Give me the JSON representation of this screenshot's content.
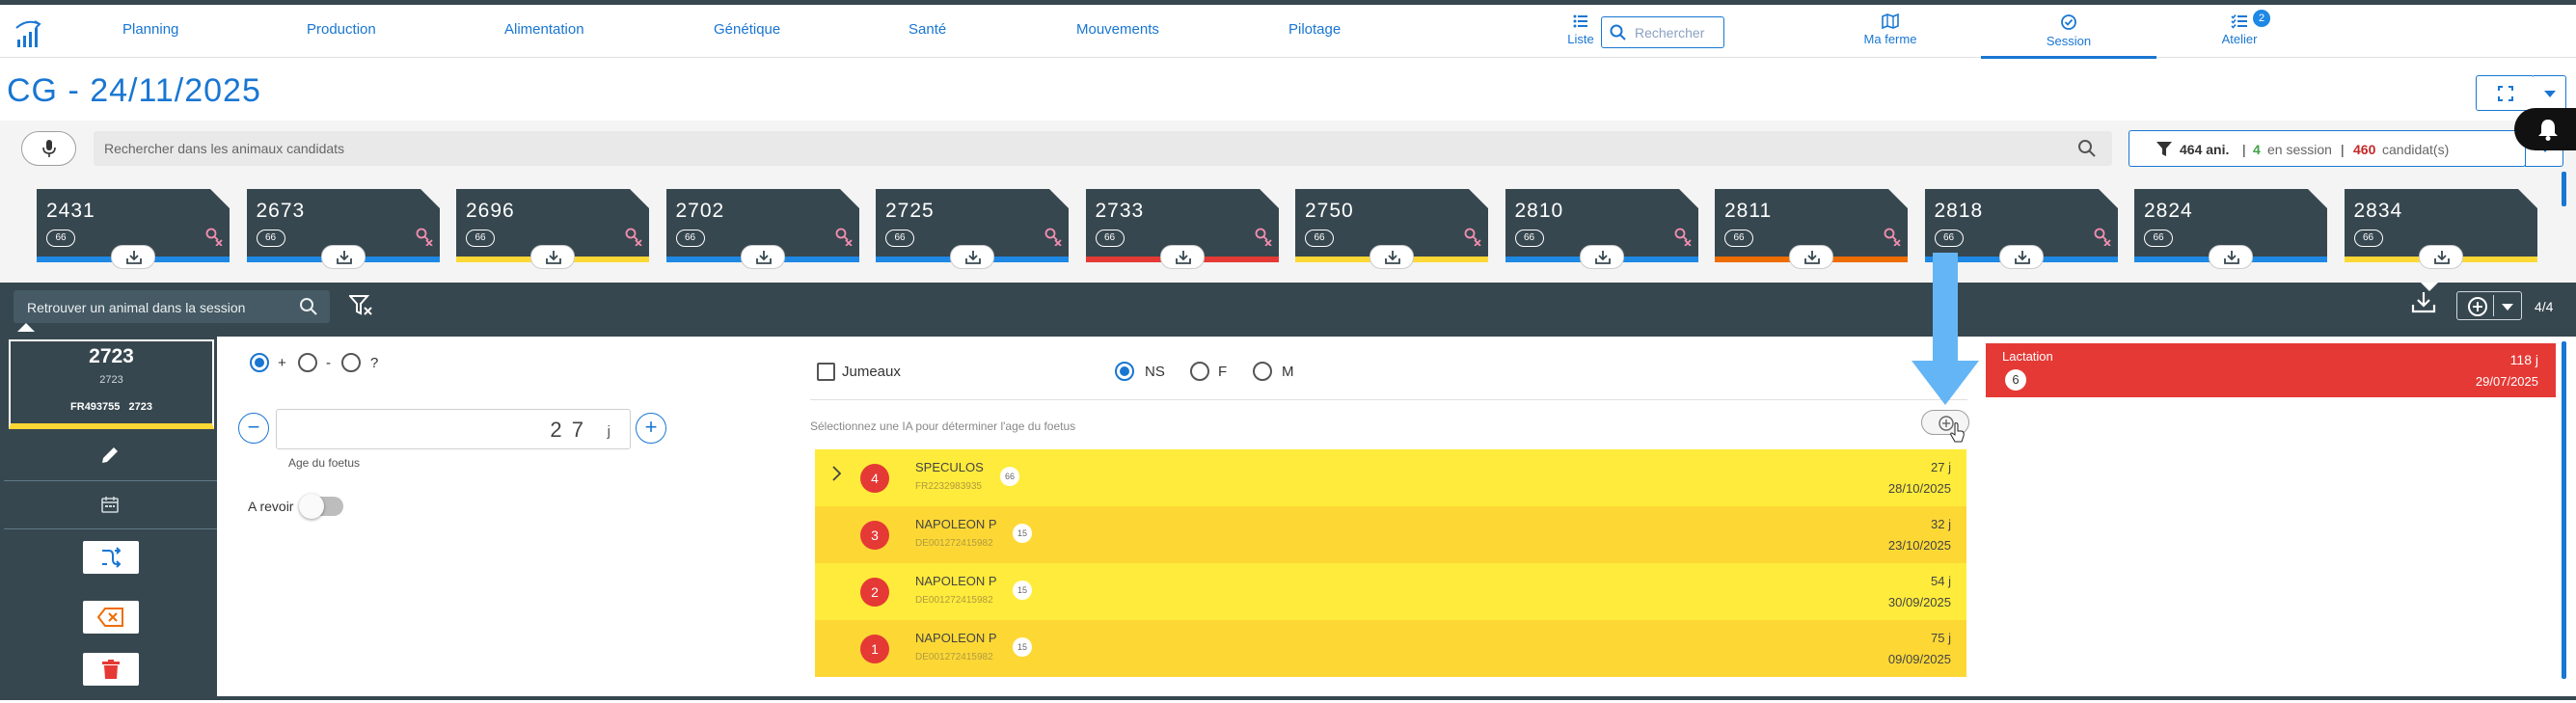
{
  "nav": {
    "items": [
      "Planning",
      "Production",
      "Alimentation",
      "Génétique",
      "Santé",
      "Mouvements",
      "Pilotage"
    ],
    "liste_label": "Liste",
    "search_placeholder": "Rechercher",
    "ma_ferme_label": "Ma ferme",
    "session_label": "Session",
    "atelier_label": "Atelier",
    "atelier_badge": "2"
  },
  "page": {
    "title": "CG - 24/11/2025"
  },
  "candidates": {
    "search_placeholder": "Rechercher dans les animaux candidats",
    "filter": {
      "total": "464 ani.",
      "sep1": "|",
      "in_session_count": "4",
      "in_session_label": "en session",
      "sep2": "|",
      "candidates_count": "460",
      "candidates_label": "candidat(s)"
    },
    "cards": [
      {
        "num": "2431",
        "pill": "66",
        "bar": "#1e88e5",
        "gender": true
      },
      {
        "num": "2673",
        "pill": "66",
        "bar": "#1e88e5",
        "gender": true
      },
      {
        "num": "2696",
        "pill": "66",
        "bar": "#fdd835",
        "gender": true
      },
      {
        "num": "2702",
        "pill": "66",
        "bar": "#1e88e5",
        "gender": true
      },
      {
        "num": "2725",
        "pill": "66",
        "bar": "#1e88e5",
        "gender": true
      },
      {
        "num": "2733",
        "pill": "66",
        "bar": "#e53935",
        "gender": true
      },
      {
        "num": "2750",
        "pill": "66",
        "bar": "#fdd835",
        "gender": true
      },
      {
        "num": "2810",
        "pill": "66",
        "bar": "#1e88e5",
        "gender": true
      },
      {
        "num": "2811",
        "pill": "66",
        "bar": "#ef6c00",
        "gender": true
      },
      {
        "num": "2818",
        "pill": "66",
        "bar": "#1e88e5",
        "gender": true
      },
      {
        "num": "2824",
        "pill": "66",
        "bar": "#1e88e5",
        "gender": false
      },
      {
        "num": "2834",
        "pill": "66",
        "bar": "#fdd835",
        "gender": false
      }
    ]
  },
  "session": {
    "search_placeholder": "Retrouver un animal dans la session",
    "page_count": "4/4"
  },
  "animal": {
    "number": "2723",
    "sub": "2723",
    "ident": "FR493755",
    "ident_num": "2723"
  },
  "form": {
    "diag_options": [
      "+",
      "-",
      "?"
    ],
    "age_value": "2 7",
    "age_unit": "j",
    "age_caption": "Age du foetus",
    "revoir_label": "A revoir",
    "jumeaux_label": "Jumeaux",
    "sex_options": [
      "NS",
      "F",
      "M"
    ],
    "ia_hint": "Sélectionnez une IA pour déterminer l'age du foetus"
  },
  "ia_list": [
    {
      "n": "4",
      "name": "SPECULOS",
      "id": "FR2232983935",
      "pill": "66",
      "days": "27 j",
      "date": "28/10/2025",
      "bg": "#ffeb3b"
    },
    {
      "n": "3",
      "name": "NAPOLEON P",
      "id": "DE001272415982",
      "pill": "15",
      "days": "32 j",
      "date": "23/10/2025",
      "bg": "#fdd835"
    },
    {
      "n": "2",
      "name": "NAPOLEON P",
      "id": "DE001272415982",
      "pill": "15",
      "days": "54 j",
      "date": "30/09/2025",
      "bg": "#ffeb3b"
    },
    {
      "n": "1",
      "name": "NAPOLEON P",
      "id": "DE001272415982",
      "pill": "15",
      "days": "75 j",
      "date": "09/09/2025",
      "bg": "#fdd835"
    }
  ],
  "lactation": {
    "title": "Lactation",
    "number": "6",
    "days": "118 j",
    "date": "29/07/2025"
  },
  "colors": {
    "primary": "#1976d2",
    "dark": "#37474f",
    "red": "#e53935",
    "yellow": "#fdd835",
    "arrow": "#64b5f6"
  }
}
